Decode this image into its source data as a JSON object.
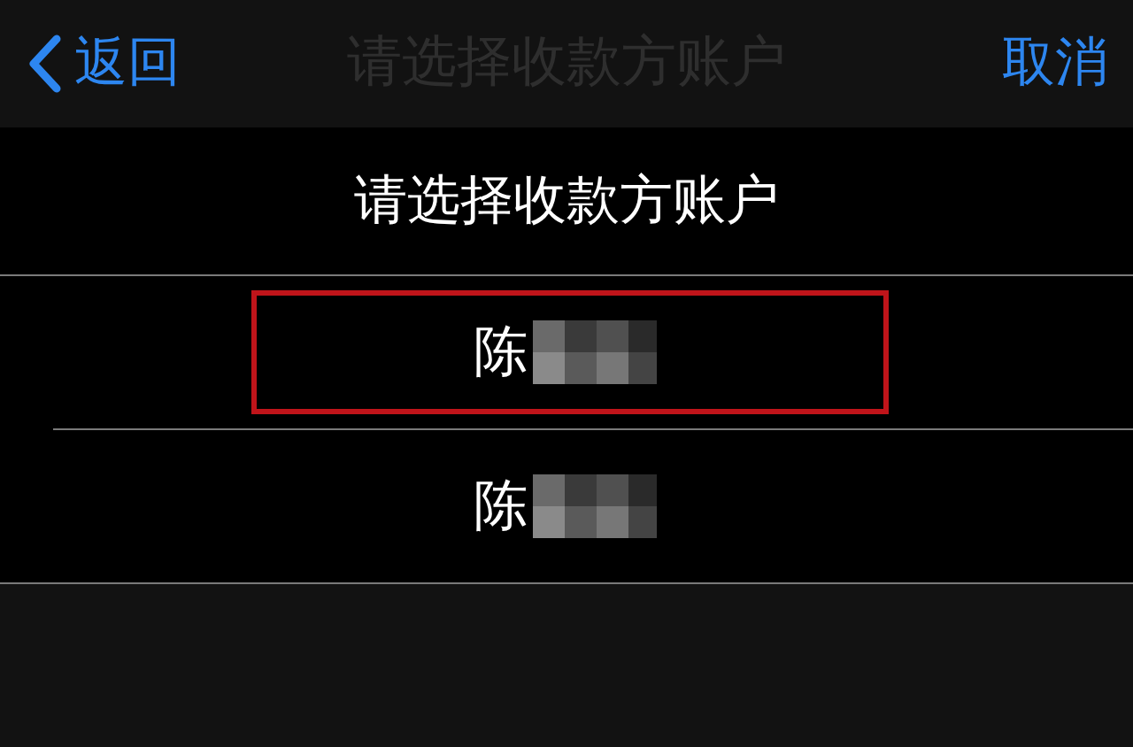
{
  "nav_bar": {
    "back": "返回",
    "title": "请选择收款方账户",
    "cancel": "取消"
  },
  "heading": "请选择收款方账户",
  "accounts": [
    {
      "name": "陈",
      "highlighted": true
    },
    {
      "name": "陈",
      "highlighted": false
    }
  ]
}
